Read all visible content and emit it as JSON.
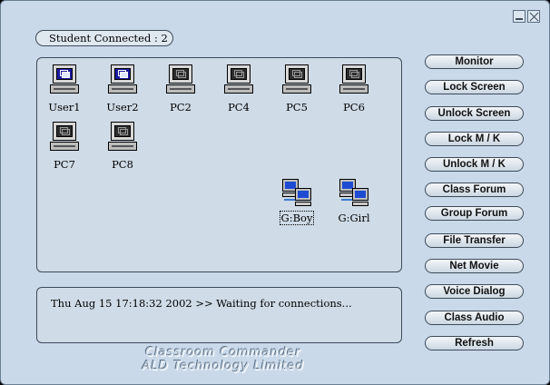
{
  "status": {
    "students_connected": "Student Connected : 2"
  },
  "computers": [
    {
      "label": "User1",
      "state": "connected",
      "icon": "computer-on-icon"
    },
    {
      "label": "User2",
      "state": "connected",
      "icon": "computer-on-icon"
    },
    {
      "label": "PC2",
      "state": "offline",
      "icon": "computer-off-icon"
    },
    {
      "label": "PC4",
      "state": "offline",
      "icon": "computer-off-icon"
    },
    {
      "label": "PC5",
      "state": "offline",
      "icon": "computer-off-icon"
    },
    {
      "label": "PC6",
      "state": "offline",
      "icon": "computer-off-icon"
    },
    {
      "label": "PC7",
      "state": "offline",
      "icon": "computer-off-icon"
    },
    {
      "label": "PC8",
      "state": "offline",
      "icon": "computer-off-icon"
    }
  ],
  "groups": [
    {
      "label": "G:Boy",
      "selected": true,
      "icon": "group-computers-icon"
    },
    {
      "label": "G:Girl",
      "selected": false,
      "icon": "group-computers-icon"
    }
  ],
  "log": {
    "message": "Thu Aug 15 17:18:32 2002 >> Waiting for connections..."
  },
  "buttons": {
    "monitor": "Monitor",
    "lock_screen": "Lock Screen",
    "unlock_screen": "Unlock Screen",
    "lock_mk": "Lock M / K",
    "unlock_mk": "Unlock M / K",
    "class_forum": "Class Forum",
    "group_forum": "Group Forum",
    "file_transfer": "File Transfer",
    "net_movie": "Net Movie",
    "voice_dialog": "Voice Dialog",
    "class_audio": "Class Audio",
    "refresh": "Refresh"
  },
  "footer": {
    "product": "Classroom Commander",
    "company": "ALD Technology Limited"
  },
  "colors": {
    "window_bg": "#c9d9e9",
    "panel_bg": "#cfdbe6",
    "screen_on": "#1a1aa0"
  }
}
